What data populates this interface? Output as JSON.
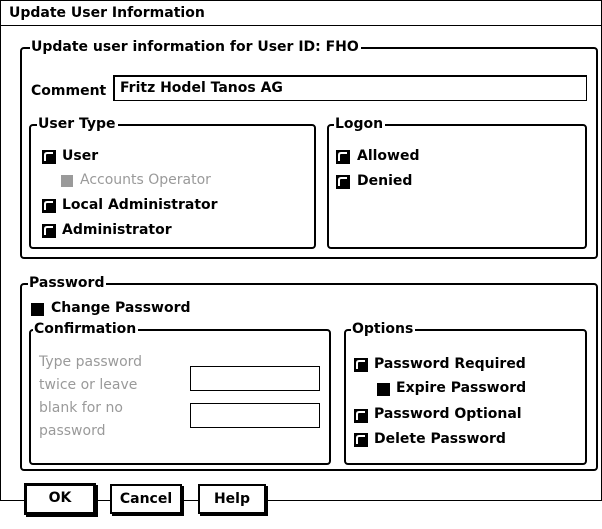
{
  "window": {
    "title": "Update User Information"
  },
  "main_group": {
    "legend": "Update user information for User ID:  FHO"
  },
  "comment": {
    "label": "Comment",
    "value": "Fritz Hodel Tanos AG"
  },
  "user_type": {
    "legend": "User Type",
    "options": [
      {
        "label": "User"
      },
      {
        "label": "Accounts Operator"
      },
      {
        "label": "Local Administrator"
      },
      {
        "label": "Administrator"
      }
    ]
  },
  "logon": {
    "legend": "Logon",
    "options": [
      {
        "label": "Allowed"
      },
      {
        "label": "Denied"
      }
    ]
  },
  "password": {
    "legend": "Password",
    "change_label": "Change Password",
    "confirmation": {
      "legend": "Confirmation",
      "hint_lines": [
        "Type password",
        "twice or leave",
        "blank for no",
        "password"
      ],
      "field1_value": "",
      "field2_value": ""
    },
    "options": {
      "legend": "Options",
      "required": "Password Required",
      "expire": "Expire Password",
      "optional": "Password Optional",
      "delete": "Delete Password"
    }
  },
  "buttons": {
    "ok": "OK",
    "cancel": "Cancel",
    "help": "Help"
  }
}
